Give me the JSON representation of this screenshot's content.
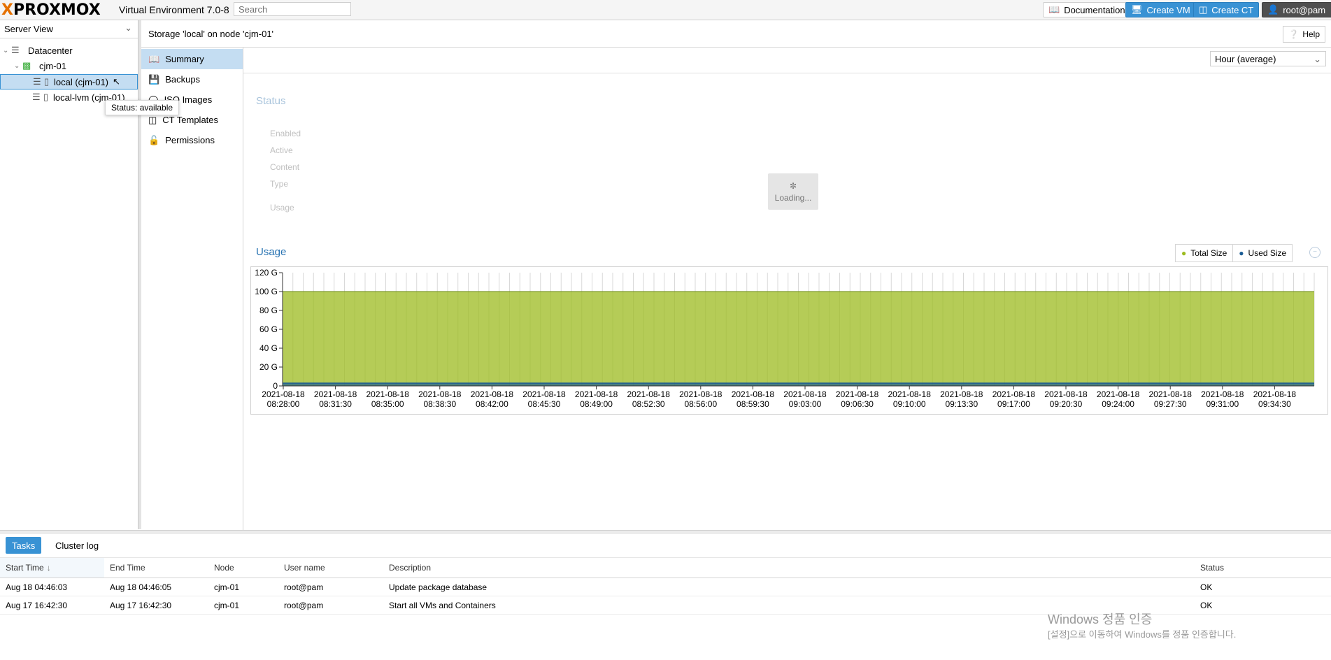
{
  "topbar": {
    "logo_x": "X",
    "logo_text": "PROXMOX",
    "version": "Virtual Environment 7.0-8",
    "search_placeholder": "Search",
    "documentation": "Documentation",
    "create_vm": "Create VM",
    "create_ct": "Create CT",
    "user": "root@pam"
  },
  "tree": {
    "view": "Server View",
    "items": [
      {
        "label": "Datacenter"
      },
      {
        "label": "cjm-01"
      },
      {
        "label": "local (cjm-01)"
      },
      {
        "label": "local-lvm (cjm-01)"
      }
    ],
    "tooltip": "Status: available"
  },
  "content": {
    "title": "Storage 'local' on node 'cjm-01'",
    "help": "Help"
  },
  "nav": [
    {
      "label": "Summary"
    },
    {
      "label": "Backups"
    },
    {
      "label": "ISO Images"
    },
    {
      "label": "CT Templates"
    },
    {
      "label": "Permissions"
    }
  ],
  "summary": {
    "timeframe": "Hour (average)",
    "status_title": "Status",
    "status_fields": [
      "Enabled",
      "Active",
      "Content",
      "Type"
    ],
    "usage_field": "Usage",
    "loading": "Loading...",
    "usage_title": "Usage",
    "legend": [
      {
        "name": "Total Size",
        "color": "#9cbb1f"
      },
      {
        "name": "Used Size",
        "color": "#1a5c94"
      }
    ]
  },
  "chart_data": {
    "type": "area",
    "ylabels": [
      "120 G",
      "100 G",
      "80 G",
      "60 G",
      "40 G",
      "20 G",
      "0"
    ],
    "ylim": [
      0,
      120
    ],
    "xlabels": [
      [
        "2021-08-18",
        "08:28:00"
      ],
      [
        "2021-08-18",
        "08:31:30"
      ],
      [
        "2021-08-18",
        "08:35:00"
      ],
      [
        "2021-08-18",
        "08:38:30"
      ],
      [
        "2021-08-18",
        "08:42:00"
      ],
      [
        "2021-08-18",
        "08:45:30"
      ],
      [
        "2021-08-18",
        "08:49:00"
      ],
      [
        "2021-08-18",
        "08:52:30"
      ],
      [
        "2021-08-18",
        "08:56:00"
      ],
      [
        "2021-08-18",
        "08:59:30"
      ],
      [
        "2021-08-18",
        "09:03:00"
      ],
      [
        "2021-08-18",
        "09:06:30"
      ],
      [
        "2021-08-18",
        "09:10:00"
      ],
      [
        "2021-08-18",
        "09:13:30"
      ],
      [
        "2021-08-18",
        "09:17:00"
      ],
      [
        "2021-08-18",
        "09:20:30"
      ],
      [
        "2021-08-18",
        "09:24:00"
      ],
      [
        "2021-08-18",
        "09:27:30"
      ],
      [
        "2021-08-18",
        "09:31:00"
      ],
      [
        "2021-08-18",
        "09:34:30"
      ]
    ],
    "series": [
      {
        "name": "Total Size",
        "value": 100,
        "color": "#9cbb1f"
      },
      {
        "name": "Used Size",
        "value": 3,
        "color": "#1a5c94"
      }
    ]
  },
  "tasks": {
    "tabs": [
      "Tasks",
      "Cluster log"
    ],
    "columns": [
      "Start Time",
      "End Time",
      "Node",
      "User name",
      "Description",
      "Status"
    ],
    "rows": [
      [
        "Aug 18 04:46:03",
        "Aug 18 04:46:05",
        "cjm-01",
        "root@pam",
        "Update package database",
        "OK"
      ],
      [
        "Aug 17 16:42:30",
        "Aug 17 16:42:30",
        "cjm-01",
        "root@pam",
        "Start all VMs and Containers",
        "OK"
      ]
    ]
  },
  "watermark": {
    "line1": "Windows 정품 인증",
    "line2": "[설정]으로 이동하여 Windows를 정품 인증합니다."
  }
}
